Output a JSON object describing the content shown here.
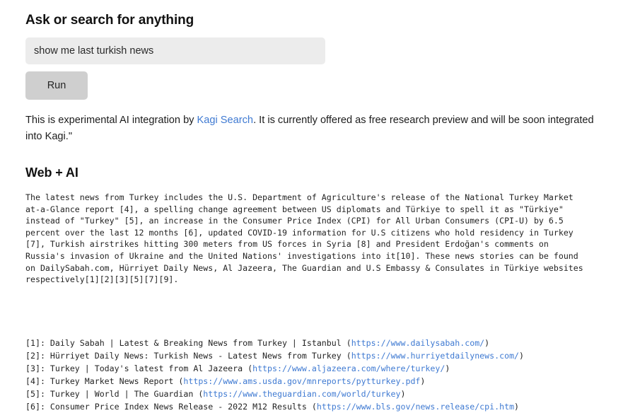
{
  "header": {
    "title": "Ask or search for anything"
  },
  "search": {
    "value": "show me last turkish news",
    "placeholder": "show me last turkish news",
    "run_label": "Run"
  },
  "disclaimer": {
    "before_link": "This is experimental AI integration by ",
    "link_label": "Kagi Search",
    "after_link": ". It is currently offered as free research preview and will be soon integrated into Kagi.\""
  },
  "result": {
    "section_title": "Web + AI",
    "answer": "The latest news from Turkey includes the U.S. Department of Agriculture's release of the National Turkey Market at-a-Glance report [4], a spelling change agreement between US diplomats and Türkiye to spell it as \"Türkiye\" instead of \"Turkey\" [5], an increase in the Consumer Price Index (CPI) for All Urban Consumers (CPI-U) by 6.5 percent over the last 12 months [6], updated COVID-19 information for U.S citizens who hold residency in Turkey [7], Turkish airstrikes hitting 300 meters from US forces in Syria [8] and President Erdoğan's comments on Russia's invasion of Ukraine and the United Nations' investigations into it[10]. These news stories can be found on DailySabah.com, Hürriyet Daily News, Al Jazeera, The Guardian and U.S Embassy & Consulates in Türkiye websites respectively[1][2][3][5][7][9]."
  },
  "references": [
    {
      "marker": "[1]: ",
      "title": "Daily Sabah | Latest & Breaking News from Turkey | Istanbul ",
      "open_paren": "(",
      "url": "https://www.dailysabah.com/",
      "close_paren": ")"
    },
    {
      "marker": "[2]: ",
      "title": "Hürriyet Daily News: Turkish News - Latest News from Turkey ",
      "open_paren": "(",
      "url": "https://www.hurriyetdailynews.com/",
      "close_paren": ")"
    },
    {
      "marker": "[3]: ",
      "title": "Turkey | Today's latest from Al Jazeera ",
      "open_paren": "(",
      "url": "https://www.aljazeera.com/where/turkey/",
      "close_paren": ")"
    },
    {
      "marker": "[4]: ",
      "title": "Turkey Market News Report ",
      "open_paren": "(",
      "url": "https://www.ams.usda.gov/mnreports/pytturkey.pdf",
      "close_paren": ")"
    },
    {
      "marker": "[5]: ",
      "title": "Turkey | World | The Guardian ",
      "open_paren": "(",
      "url": "https://www.theguardian.com/world/turkey",
      "close_paren": ")"
    },
    {
      "marker": "[6]: ",
      "title": "Consumer Price Index News Release - 2022 M12 Results ",
      "open_paren": "(",
      "url": "https://www.bls.gov/news.release/cpi.htm",
      "close_paren": ")"
    }
  ],
  "colors": {
    "link": "#3f7ad2",
    "input_bg": "#ececec",
    "button_bg": "#cfcfcf",
    "text": "#232323"
  }
}
